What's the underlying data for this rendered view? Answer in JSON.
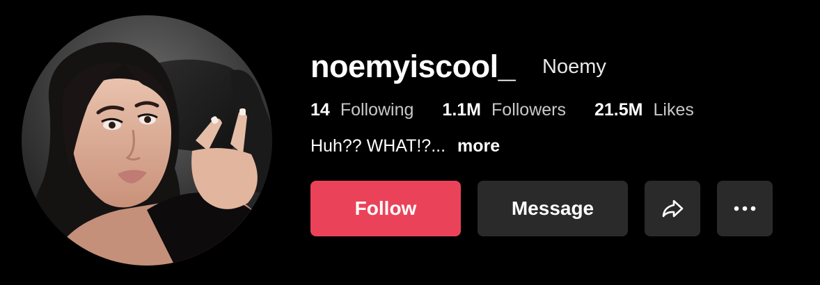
{
  "profile": {
    "username": "noemyiscool_",
    "display_name": "Noemy",
    "bio": "Huh?? WHAT!?...",
    "bio_more": "more"
  },
  "stats": [
    {
      "value": "14",
      "label": "Following"
    },
    {
      "value": "1.1M",
      "label": "Followers"
    },
    {
      "value": "21.5M",
      "label": "Likes"
    }
  ],
  "actions": {
    "follow_label": "Follow",
    "message_label": "Message",
    "share_icon": "share-arrow-icon",
    "more_icon": "more-horizontal-icon"
  },
  "colors": {
    "background": "#000000",
    "follow_button": "#ea4359",
    "secondary_button": "#2a2a2a",
    "muted_text": "#c9c9c9"
  }
}
